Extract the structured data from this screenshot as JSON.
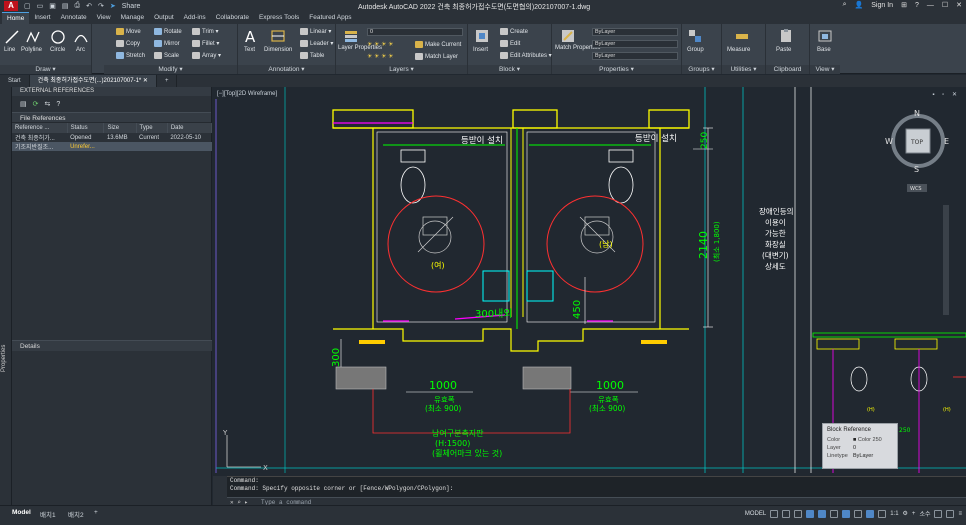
{
  "window": {
    "title": "Autodesk AutoCAD 2022    건축 최종허가접수도면(도면협의)202107007-1.dwg",
    "share": "Share",
    "sign_in": "Sign In"
  },
  "ribbon_tabs": [
    "Home",
    "Insert",
    "Annotate",
    "View",
    "Manage",
    "Output",
    "Add-ins",
    "Collaborate",
    "Express Tools",
    "Featured Apps"
  ],
  "draw": {
    "line": "Line",
    "polyline": "Polyline",
    "circle": "Circle",
    "arc": "Arc",
    "label": "Draw ▾"
  },
  "modify": {
    "move": "Move",
    "rotate": "Rotate",
    "trim": "Trim ▾",
    "copy": "Copy",
    "mirror": "Mirror",
    "fillet": "Fillet ▾",
    "stretch": "Stretch",
    "scale": "Scale",
    "array": "Array ▾",
    "label": "Modify ▾"
  },
  "annotation": {
    "text": "Text",
    "dimension": "Dimension",
    "linear": "Linear ▾",
    "leader": "Leader ▾",
    "table": "Table",
    "label": "Annotation ▾"
  },
  "layers": {
    "layer_properties": "Layer Properties",
    "current_layer": "0",
    "make_current": "Make Current",
    "match_layer": "Match Layer",
    "label": "Layers ▾"
  },
  "block": {
    "insert": "Insert",
    "create": "Create",
    "edit": "Edit",
    "edit_attributes": "Edit Attributes ▾",
    "label": "Block ▾"
  },
  "properties": {
    "match": "Match Properties",
    "color": "ByLayer",
    "linetype": "ByLayer",
    "lineweight": "ByLayer",
    "label": "Properties ▾"
  },
  "groups": {
    "group": "Group",
    "label": "Groups ▾"
  },
  "utilities": {
    "measure": "Measure",
    "label": "Utilities ▾"
  },
  "clipboard": {
    "paste": "Paste",
    "label": "Clipboard"
  },
  "view_panel": {
    "base": "Base",
    "label": "View ▾"
  },
  "file_tabs": [
    "Start",
    "건축 최종허가접수도면(...)202107007-1*"
  ],
  "xref": {
    "panel_title": "EXTERNAL REFERENCES",
    "file_refs_label": "File References",
    "columns": [
      "Reference ...",
      "Status",
      "Size",
      "Type",
      "Date"
    ],
    "rows": [
      {
        "name": "건축 최종허가...",
        "status": "Opened",
        "size": "13.6MB",
        "type": "Current",
        "date": "2022-05-10"
      },
      {
        "name": "기조지반질조...",
        "status": "Unrefer...",
        "size": "",
        "type": "",
        "date": ""
      }
    ],
    "details_label": "Details",
    "properties_label": "Properties"
  },
  "viewport": {
    "label": "[−][Top][2D Wireframe]",
    "controls": "▪ ▫ ✕"
  },
  "viewcube": {
    "top": "TOP",
    "n": "N",
    "s": "S",
    "e": "E",
    "w": "W",
    "wcs": "WCS"
  },
  "drawing": {
    "label_left_fixture": "등받이 설치",
    "label_right_fixture": "등받이 설치",
    "female": "(여)",
    "male": "(남)",
    "dim_250": "250",
    "dim_2140": "2140",
    "dim_2140_sub": "(최소 1,800)",
    "dim_300_inner": "300내외",
    "dim_450": "450",
    "dim_300": "300",
    "dim_1000_left": "1000",
    "dim_1000_right": "1000",
    "effective_width_left": "유효폭",
    "effective_width_left_sub": "(최소 900)",
    "effective_width_right": "유효폭",
    "effective_width_right_sub": "(최소 900)",
    "tactile_1": "남여구분촉지판",
    "tactile_2": "(H:1500)",
    "tactile_3": "(휠체어마크 있는 것)",
    "note_1": "장애인등의",
    "note_2": "이용이",
    "note_3": "가능한",
    "note_4": "화장실",
    "note_5": "(대변기)",
    "note_6": "상세도",
    "small_tag_1": "(H)",
    "small_tag_2": "(H)",
    "small_tag_3": "250"
  },
  "tooltip": {
    "title": "Block Reference",
    "color_label": "Color",
    "color_value": "Color 250",
    "layer_label": "Layer",
    "layer_value": "0",
    "linetype_label": "Linetype",
    "linetype_value": "ByLayer"
  },
  "command": {
    "line1": "Command:",
    "line2": "Command: Specify opposite corner or [Fence/WPolygon/CPolygon]:",
    "placeholder": "Type a command"
  },
  "status_bar": {
    "tabs": [
      "Model",
      "배치1",
      "배치2"
    ],
    "model_label": "MODEL",
    "scale": "1:1",
    "units": "소수"
  },
  "colors": {
    "background": "#212830",
    "wall": "#ffff00",
    "green": "#00ff00",
    "cyan": "#00ffff",
    "magenta": "#ff00ff",
    "red": "#ff3030",
    "white": "#ffffff"
  }
}
